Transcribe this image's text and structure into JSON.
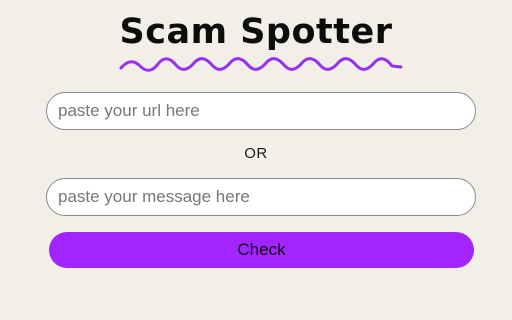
{
  "header": {
    "title": "Scam Spotter"
  },
  "form": {
    "url_placeholder": "paste your url here",
    "url_value": "",
    "separator": "OR",
    "message_placeholder": "paste your message here",
    "message_value": "",
    "check_label": "Check"
  },
  "colors": {
    "accent": "#a224ff",
    "background": "#f2efe8",
    "underline": "#9b2ff0"
  },
  "icons": {
    "underline": "squiggle-underline"
  }
}
